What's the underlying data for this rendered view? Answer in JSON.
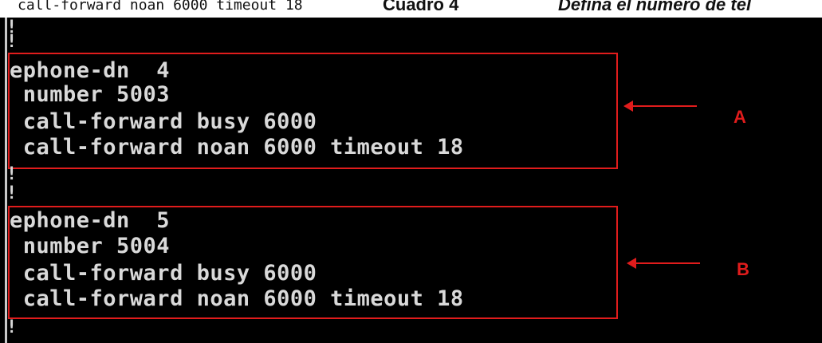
{
  "caption": {
    "code_text": "call-forward noan 6000 timeout 18",
    "title_bold": "Cuadro 4",
    "title_italic": "Defina el número de tel"
  },
  "console": {
    "prompt_char": "!",
    "blocks": [
      {
        "tag": "A",
        "lines": [
          "ephone-dn  4",
          " number 5003",
          " call-forward busy 6000",
          " call-forward noan 6000 timeout 18"
        ]
      },
      {
        "tag": "B",
        "lines": [
          "ephone-dn  5",
          " number 5004",
          " call-forward busy 6000",
          " call-forward noan 6000 timeout 18"
        ]
      }
    ]
  },
  "colors": {
    "console_bg": "#000000",
    "console_text": "#d9d9d9",
    "highlight": "#e01c1c"
  }
}
